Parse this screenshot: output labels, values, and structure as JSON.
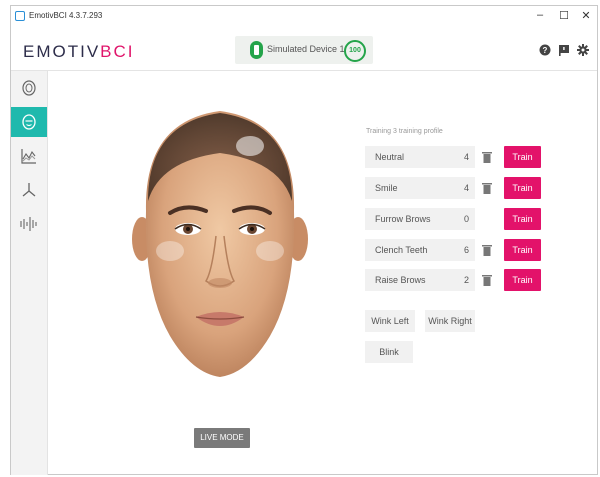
{
  "window": {
    "title": "EmotivBCI 4.3.7.293",
    "controls": {
      "minimize": "–",
      "maximize": "☐",
      "close": "✕"
    }
  },
  "brand": {
    "emotiv": "EMOTIV",
    "bci": "BCI"
  },
  "device": {
    "name": "Simulated Device 1",
    "quality": "100",
    "status_color": "#24a44a"
  },
  "header_icons": [
    "help-icon",
    "feedback-flag-icon",
    "settings-gear-icon"
  ],
  "sidebar": {
    "items": [
      {
        "name": "brain-icon",
        "active": false
      },
      {
        "name": "facial-expressions-icon",
        "active": true
      },
      {
        "name": "performance-metrics-icon",
        "active": false
      },
      {
        "name": "motion-icon",
        "active": false
      },
      {
        "name": "eeg-waves-icon",
        "active": false
      }
    ],
    "active_color": "#1fb9ad"
  },
  "main": {
    "profile_caption": "Training 3 training profile",
    "actions": [
      {
        "label": "Neutral",
        "count": "4",
        "has_delete": true,
        "train_label": "Train"
      },
      {
        "label": "Smile",
        "count": "4",
        "has_delete": true,
        "train_label": "Train"
      },
      {
        "label": "Furrow Brows",
        "count": "0",
        "has_delete": false,
        "train_label": "Train"
      },
      {
        "label": "Clench Teeth",
        "count": "6",
        "has_delete": true,
        "train_label": "Train"
      },
      {
        "label": "Raise Brows",
        "count": "2",
        "has_delete": true,
        "train_label": "Train"
      }
    ],
    "extra_actions": [
      {
        "label": "Wink Left"
      },
      {
        "label": "Wink Right"
      },
      {
        "label": "Blink"
      }
    ],
    "live_mode_label": "LIVE MODE",
    "train_color": "#e3126a"
  }
}
